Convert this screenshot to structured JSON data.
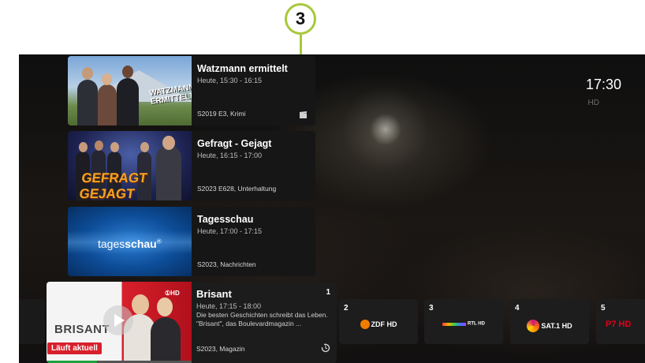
{
  "callout": {
    "number": "3"
  },
  "clock": {
    "time": "17:30",
    "subtitle": "HD"
  },
  "programs": [
    {
      "title": "Watzmann ermittelt",
      "time": "Heute, 15:30 - 16:15",
      "meta": "S2019 E3, Krimi",
      "icon": "clapperboard-icon",
      "thumb_text": "WATZMANN ERMITTELT"
    },
    {
      "title": "Gefragt - Gejagt",
      "time": "Heute, 16:15 - 17:00",
      "meta": "S2023 E628, Unterhaltung",
      "thumb_text": "GEFRAGT GEJAGT"
    },
    {
      "title": "Tagesschau",
      "time": "Heute, 17:00 - 17:15",
      "meta": "S2023, Nachrichten",
      "thumb_text_a": "tages",
      "thumb_text_b": "schau",
      "thumb_mark": "®"
    }
  ],
  "focused": {
    "title": "Brisant",
    "channel_number": "1",
    "time": "Heute, 17:15 - 18:00",
    "description": "Die besten Geschichten schreibt das Leben. \"Brisant\", das Boulevardmagazin ...",
    "meta": "S2023, Magazin",
    "badge": "Läuft aktuell",
    "thumb_brand": "BRISANT",
    "thumb_channel": "①HD",
    "progress": 0.35,
    "icon": "replay-icon"
  },
  "channels": [
    {
      "number": "2",
      "logo": "ZDF HD",
      "color": "#f07d00"
    },
    {
      "number": "3",
      "logo": "RTL HD",
      "color": "#6a5cff"
    },
    {
      "number": "4",
      "logo": "SAT.1 HD",
      "color": "#d0127a"
    },
    {
      "number": "5",
      "logo": "P7 HD",
      "color": "#e3001b"
    }
  ],
  "colors": {
    "accent": "#a8c83a",
    "live": "#d8202b",
    "progress": "#1ea13b"
  }
}
